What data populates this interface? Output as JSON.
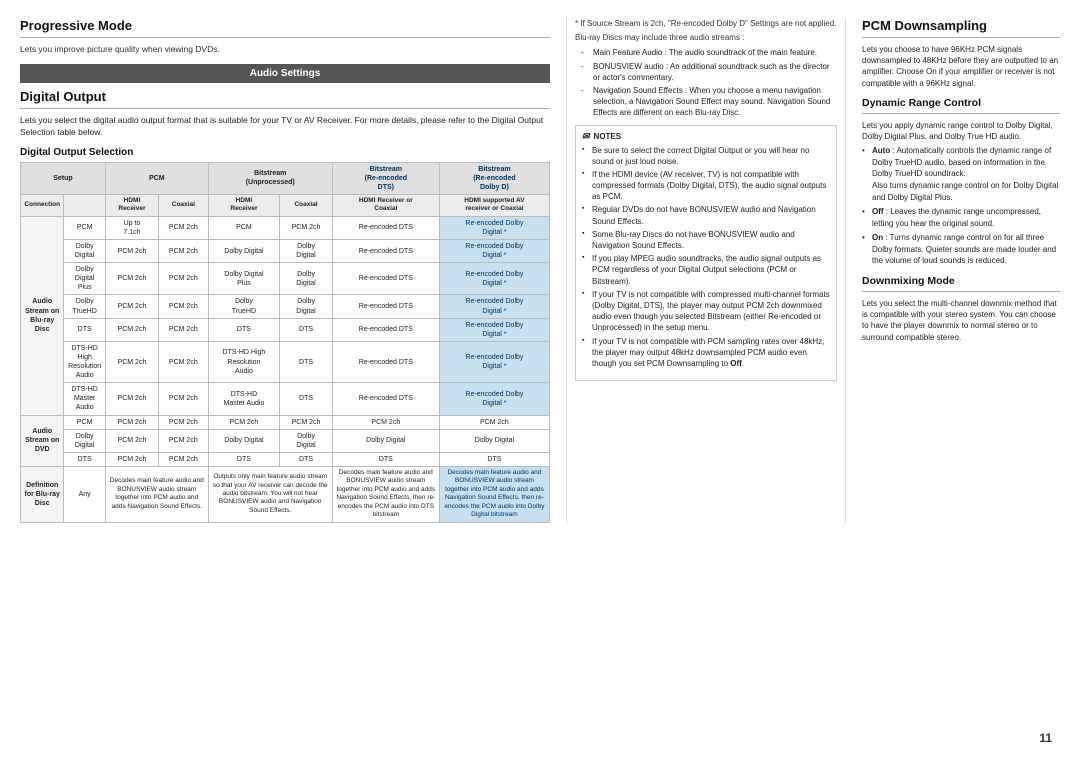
{
  "progressive": {
    "title": "Progressive Mode",
    "description": "Lets you improve picture quality when viewing DVDs."
  },
  "audio_settings": {
    "bar_label": "Audio Settings"
  },
  "digital_output": {
    "title": "Digital Output",
    "description": "Lets you select the digital audio output format that is suitable for your TV or AV Receiver. For more details, please refer to the Digital Output Selection table below.",
    "selection_title": "Digital Output Selection"
  },
  "table": {
    "headers": {
      "setup": "Setup",
      "pcm": "PCM",
      "bitstream_unprocessed": "Bitstream (Unprocessed)",
      "bitstream_reencoded_dts": "Bitstream (Re-encoded DTS)",
      "bitstream_reencoded_dolby": "Bitstream (Re-encoded Dolby D)"
    },
    "sub_headers": {
      "connection": "Connection",
      "hdmi_receiver": "HDMI Receiver",
      "coaxial": "Coaxial",
      "hdmi_receiver2": "HDMI Receiver",
      "coaxial2": "Coaxial",
      "hdmi_receiver_or_coaxial": "HDMI Receiver or Coaxial",
      "hdmi_supported_av": "HDMI supported AV receiver or Coaxial"
    },
    "rows": {
      "audio_stream_bluray": {
        "label": "Audio Stream on Blu-ray Disc",
        "pcm": "PCM",
        "dolby_digital": "Dolby Digital",
        "dolby_digital_plus": "Dolby Digital Plus",
        "dolby_truehd": "Dolby TrueHD",
        "dts": "DTS",
        "dts_hd_high": "DTS-HD High Resolution Audio",
        "dts_hd_master": "DTS-HD Master Audio"
      },
      "audio_stream_dvd": {
        "label": "Audio Stream on DVD",
        "pcm": "PCM",
        "dolby_digital": "Dolby Digital",
        "dts": "DTS"
      }
    }
  },
  "middle": {
    "star_note": "* If Source Stream is 2ch, \"Re-encoded Dolby D\" Settings are not applied.",
    "bluray_note": "Blu-ray Discs may include three audio streams :",
    "streams": [
      "Main Feature Audio : The audio soundtrack of the main feature.",
      "BONUSVIEW audio : An additional soundtrack such as the director or actor's commentary.",
      "Navigation Sound Effects : When you choose a menu navigation selection, a Navigation Sound Effect may sound. Navigation Sound Effects are different on each Blu-ray Disc."
    ],
    "notes_title": "NOTES",
    "notes": [
      "Be sure to select the correct Digital Output or you will hear no sound or just loud noise.",
      "If the HDMI device (AV receiver, TV) is not compatible with compressed formats (Dolby Digital, DTS), the audio signal outputs as PCM.",
      "Regular DVDs do not have BONUSVIEW audio and Navigation Sound Effects.",
      "Some Blu-ray Discs do not have BONUSVIEW audio and Navigation Sound Effects.",
      "If you play MPEG audio soundtracks, the audio signal outputs as PCM regardless of your Digital Output selections (PCM or Bitstream).",
      "If your TV is not compatible with compressed multi-channel formats (Dolby Digital, DTS), the player may output PCM 2ch downmixed audio even though you selected Bitstream (either Re-encoded or Unprocessed) in the setup menu.",
      "If your TV is not compatible with PCM sampling rates over 48kHz, the player may output 48kHz downsampled PCM audio even though you set PCM Downsampling to Off."
    ]
  },
  "right": {
    "pcm_downsampling": {
      "title": "PCM Downsampling",
      "description": "Lets you choose to have 96KHz PCM signals downsampled to 48KHz before they are outputted to an amplifier. Choose On if your amplifier or receiver is not compatible with a 96KHz signal."
    },
    "dynamic_range": {
      "title": "Dynamic Range Control",
      "description": "Lets you apply dynamic range control to Dolby Digital, Dolby Digital Plus, and Dolby True HD audio.",
      "bullets": [
        "Auto : Automatically controls the dynamic range of Dolby TrueHD audio, based on information in the Dolby TrueHD soundtrack. Also turns dynamic range control on for Dolby Digital and Dolby Digital Plus.",
        "Off : Leaves the dynamic range uncompressed, letting you hear the original sound.",
        "On : Turns dynamic range control on for all three Dolby formats. Quieter sounds are made louder and the volume of loud sounds is reduced."
      ]
    },
    "downmixing": {
      "title": "Downmixing Mode",
      "description": "Lets you select the multi-channel downmix method that is compatible with your stereo system. You can choose to have the player downmix to normal stereo or to surround compatible stereo."
    }
  },
  "page_number": "11"
}
